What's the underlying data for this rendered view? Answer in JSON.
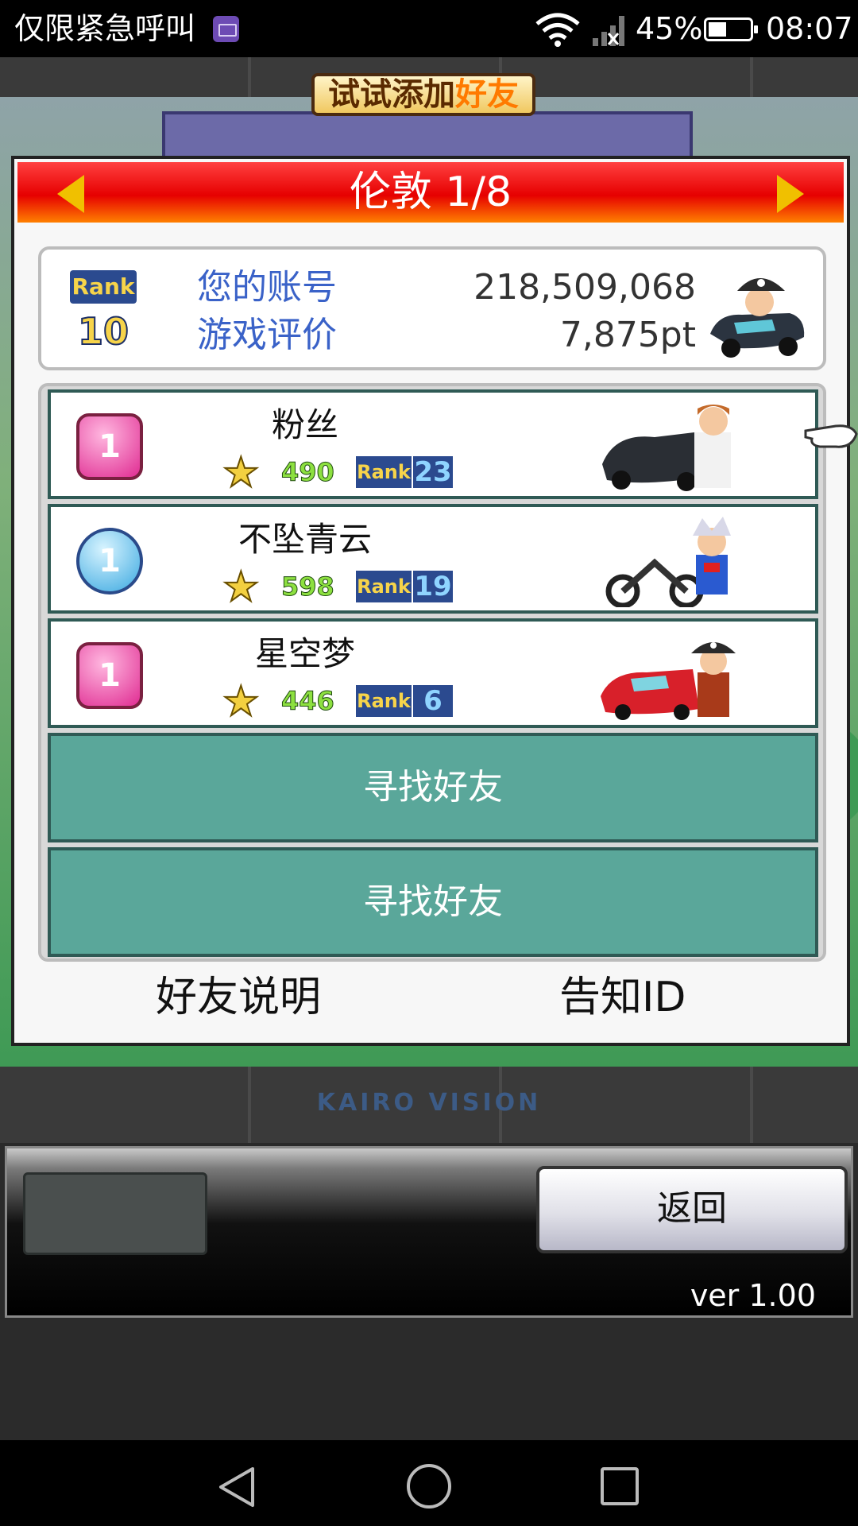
{
  "status_bar": {
    "carrier_text": "仅限紧急呼叫",
    "battery_percent": "45%",
    "battery_level": 0.45,
    "time": "08:07",
    "icons": [
      "keyboard-icon",
      "wifi-icon",
      "signal-icon",
      "battery-icon"
    ]
  },
  "game": {
    "banner_prefix": "试试添加",
    "banner_highlight": "好友",
    "brand": "KAIRO VISION"
  },
  "panel": {
    "title": "伦敦 1/8",
    "profile": {
      "rank_label": "Rank",
      "rank_value": "10",
      "account_label": "您的账号",
      "account_value": "218,509,068",
      "evaluation_label": "游戏评价",
      "evaluation_value": "7,875pt"
    },
    "friends": [
      {
        "badge": "1",
        "badge_style": "pink",
        "name": "粉丝",
        "score": "490",
        "rank_label": "Rank",
        "rank": "23"
      },
      {
        "badge": "1",
        "badge_style": "blue",
        "name": "不坠青云",
        "score": "598",
        "rank_label": "Rank",
        "rank": "19"
      },
      {
        "badge": "1",
        "badge_style": "pink",
        "name": "星空梦",
        "score": "446",
        "rank_label": "Rank",
        "rank": "6"
      }
    ],
    "find_buttons": [
      "寻找好友",
      "寻找好友"
    ],
    "footer_left": "好友说明",
    "footer_right": "告知ID"
  },
  "controls": {
    "back_label": "返回",
    "version": "ver 1.00"
  },
  "colors": {
    "header_red": "#e60000",
    "find_teal": "#5aa79a",
    "label_blue": "#3a62c8"
  }
}
